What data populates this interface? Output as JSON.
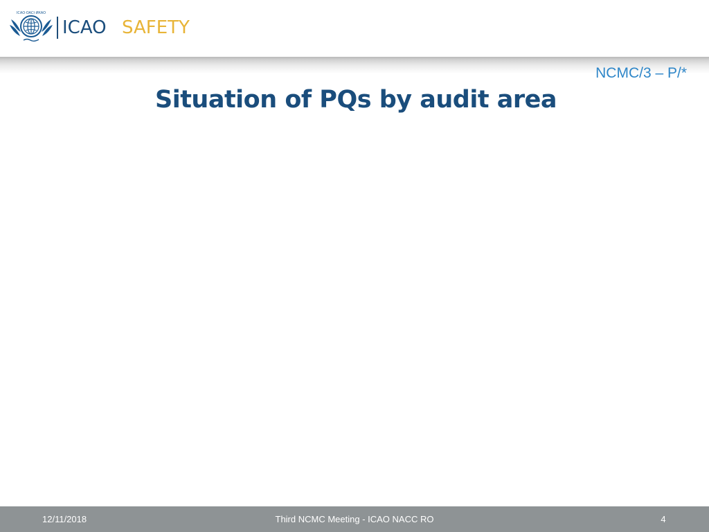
{
  "header": {
    "logo_icon": "icao-emblem-icon",
    "brand_name": "ICAO",
    "brand_tagline": "SAFETY",
    "colors": {
      "brand_blue": "#1a4d7c",
      "safety_gold": "#e8b437"
    }
  },
  "slide": {
    "reference": "NCMC/3 – P/*",
    "title": "Situation of PQs by audit area",
    "colors": {
      "reference": "#2e86c8",
      "title": "#1a4d7c"
    }
  },
  "footer": {
    "date": "12/11/2018",
    "event": "Third NCMC Meeting - ICAO NACC RO",
    "page_number": "4",
    "background": "#8e9395"
  }
}
